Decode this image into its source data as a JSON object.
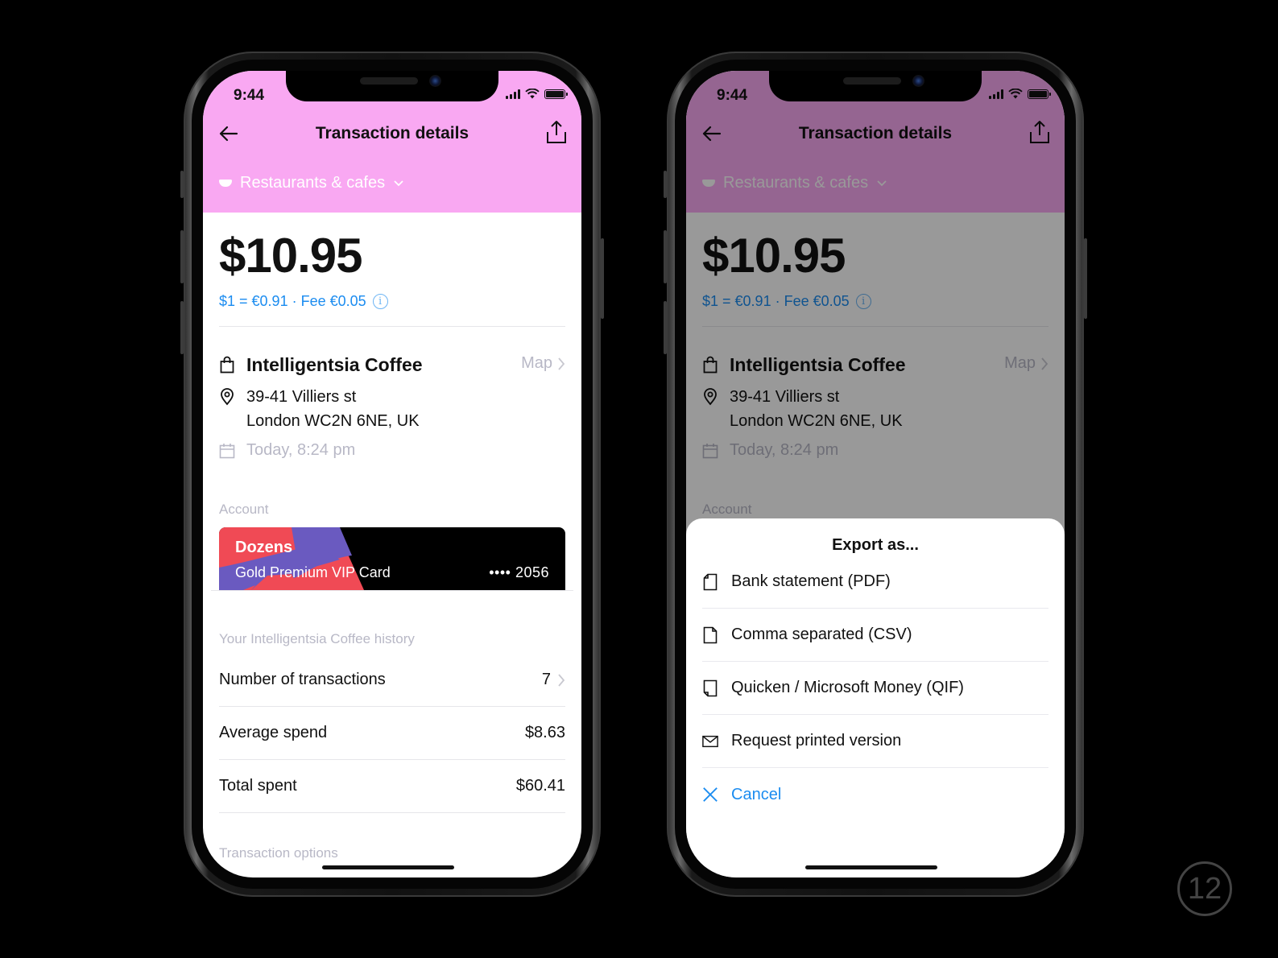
{
  "status_bar": {
    "time": "9:44"
  },
  "nav": {
    "title": "Transaction details"
  },
  "category": {
    "label": "Restaurants & cafes"
  },
  "transaction": {
    "amount": "$10.95",
    "fx_info": "$1 = €0.91 · Fee €0.05",
    "merchant": "Intelligentsia Coffee",
    "map_label": "Map",
    "address_line1": "39-41 Villiers st",
    "address_line2": "London WC2N 6NE, UK",
    "date": "Today, 8:24 pm"
  },
  "account": {
    "section_label": "Account",
    "card_name": "Dozens",
    "card_type": "Gold Premium VIP Card",
    "card_number": "•••• 2056"
  },
  "history": {
    "section_label": "Your Intelligentsia Coffee history",
    "rows": [
      {
        "label": "Number of transactions",
        "value": "7"
      },
      {
        "label": "Average spend",
        "value": "$8.63"
      },
      {
        "label": "Total spent",
        "value": "$60.41"
      }
    ]
  },
  "transaction_options": {
    "section_label": "Transaction options"
  },
  "export_sheet": {
    "title": "Export as...",
    "items": [
      {
        "label": "Bank statement (PDF)",
        "icon": "pdf-document-icon"
      },
      {
        "label": "Comma separated (CSV)",
        "icon": "csv-document-icon"
      },
      {
        "label": "Quicken / Microsoft Money (QIF)",
        "icon": "qif-document-icon"
      },
      {
        "label": "Request printed version",
        "icon": "envelope-icon"
      }
    ],
    "cancel_label": "Cancel"
  },
  "colors": {
    "header_pink": "#f9a8f2",
    "accent_blue": "#1b8cf0",
    "muted_text": "#b8b8c6"
  },
  "page_number": "12"
}
